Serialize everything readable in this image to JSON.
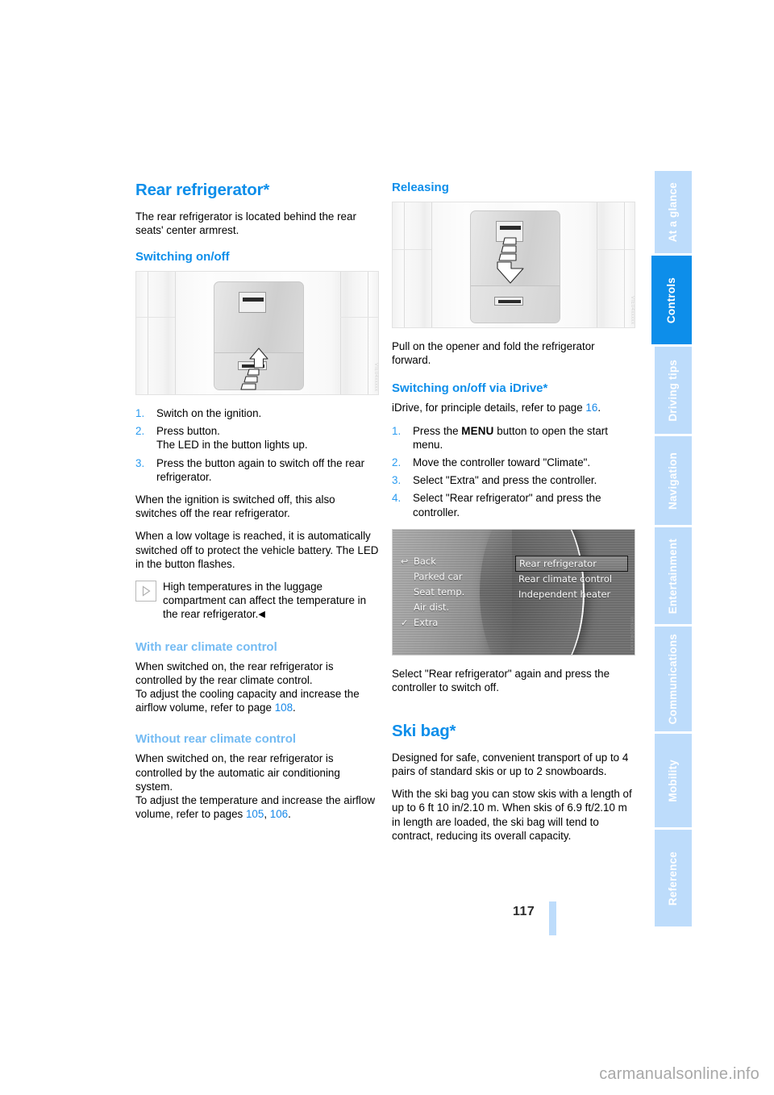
{
  "document": {
    "page_number": "117",
    "watermark": "carmanualsonline.info"
  },
  "tabs": [
    {
      "label": "At a glance",
      "active": false
    },
    {
      "label": "Controls",
      "active": true
    },
    {
      "label": "Driving tips",
      "active": false
    },
    {
      "label": "Navigation",
      "active": false
    },
    {
      "label": "Entertainment",
      "active": false
    },
    {
      "label": "Communications",
      "active": false
    },
    {
      "label": "Mobility",
      "active": false
    },
    {
      "label": "Reference",
      "active": false
    }
  ],
  "colors": {
    "heading_blue": "#0d8eea",
    "subheading_light_blue": "#74bbf3",
    "tab_inactive": "#bddcfb",
    "tab_active": "#0d8eea",
    "page_ref_link": "#1788e8"
  },
  "left_column": {
    "title": "Rear refrigerator*",
    "intro": "The rear refrigerator is located behind the rear seats' center armrest.",
    "switching_heading": "Switching on/off",
    "figure_code": "VIE04xxxxx",
    "steps": [
      {
        "num": "1.",
        "text": "Switch on the ignition."
      },
      {
        "num": "2.",
        "text": "Press button.\nThe LED in the button lights up."
      },
      {
        "num": "3.",
        "text": "Press the button again to switch off the rear refrigerator."
      }
    ],
    "para_ignition_off": "When the ignition is switched off, this also switches off the rear refrigerator.",
    "para_low_voltage": "When a low voltage is reached, it is automatically switched off to protect the vehicle battery. The LED in the button flashes.",
    "notice": {
      "icon": "notice-triangle-icon",
      "text": "High temperatures in the luggage compartment can affect the temperature in the rear refrigerator.",
      "end_mark": "◀"
    },
    "with_climate": {
      "heading": "With rear climate control",
      "para1": "When switched on, the rear refrigerator is controlled by the rear climate control.",
      "para2_pre": "To adjust the cooling capacity and increase the airflow volume, refer to page ",
      "para2_ref": "108",
      "para2_post": "."
    },
    "without_climate": {
      "heading": "Without rear climate control",
      "para1": "When switched on, the rear refrigerator is controlled by the automatic air conditioning system.",
      "para2_pre": "To adjust the temperature and increase the airflow volume, refer to pages ",
      "para2_ref1": "105",
      "para2_mid": ", ",
      "para2_ref2": "106",
      "para2_post": "."
    }
  },
  "right_column": {
    "releasing_heading": "Releasing",
    "releasing_figure_code": "VIE04xxxxx",
    "releasing_text": "Pull on the opener and fold the refrigerator forward.",
    "idrive_heading": "Switching on/off via iDrive*",
    "idrive_intro_pre": "iDrive, for principle details, refer to page ",
    "idrive_intro_ref": "16",
    "idrive_intro_post": ".",
    "idrive_steps": [
      {
        "num": "1.",
        "pre": "Press the ",
        "bold": "MENU",
        "post": " button to open the start menu."
      },
      {
        "num": "2.",
        "pre": "Move the controller toward \"Climate\".",
        "bold": "",
        "post": ""
      },
      {
        "num": "3.",
        "pre": "Select \"Extra\" and press the controller.",
        "bold": "",
        "post": ""
      },
      {
        "num": "4.",
        "pre": "Select \"Rear refrigerator\" and press the controller.",
        "bold": "",
        "post": ""
      }
    ],
    "idrive_screen": {
      "figure_code": "IHKIC04xxxx",
      "left_menu": [
        {
          "label": "Back",
          "glyph": "↩",
          "checked": false
        },
        {
          "label": "Parked car",
          "glyph": "",
          "checked": false
        },
        {
          "label": "Seat temp.",
          "glyph": "",
          "checked": false
        },
        {
          "label": "Air dist.",
          "glyph": "",
          "checked": false
        },
        {
          "label": "Extra",
          "glyph": "✓",
          "checked": true
        }
      ],
      "right_menu": [
        {
          "label": "Rear refrigerator",
          "selected": true
        },
        {
          "label": "Rear climate control",
          "selected": false
        },
        {
          "label": "Independent heater",
          "selected": false
        }
      ]
    },
    "idrive_switch_off": "Select \"Rear refrigerator\" again and press the controller to switch off.",
    "ski_bag": {
      "title": "Ski bag*",
      "para1": "Designed for safe, convenient transport of up to 4 pairs of standard skis or up to 2 snowboards.",
      "para2": "With the ski bag you can stow skis with a length of up to 6 ft 10 in/2.10 m. When skis of 6.9 ft/2.10 m in length are loaded, the ski bag will tend to contract, reducing its overall capacity."
    }
  }
}
